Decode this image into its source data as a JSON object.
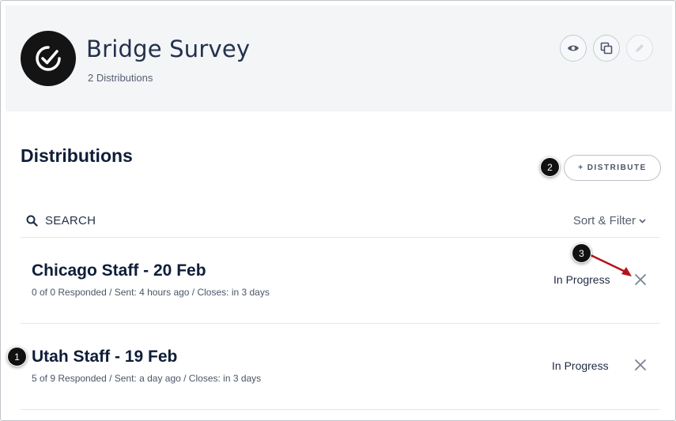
{
  "header": {
    "title": "Bridge Survey",
    "subtitle": "2 Distributions",
    "actions": [
      "preview-icon",
      "copy-icon",
      "edit-icon"
    ]
  },
  "main": {
    "heading": "Distributions",
    "distribute_label": "+ DISTRIBUTE",
    "search_label": "SEARCH",
    "sort_label": "Sort & Filter"
  },
  "distributions": [
    {
      "title": "Chicago Staff - 20 Feb",
      "meta": "0 of 0 Responded  / Sent: 4 hours ago  / Closes: in 3 days",
      "status": "In Progress"
    },
    {
      "title": "Utah Staff - 19 Feb",
      "meta": "5 of 9 Responded  / Sent: a day ago  / Closes: in 3 days",
      "status": "In Progress"
    }
  ],
  "callouts": [
    "1",
    "2",
    "3"
  ],
  "colors": {
    "header_bg": "#f4f5f7",
    "text_dark": "#0f1d38",
    "arrow": "#b5121b"
  }
}
